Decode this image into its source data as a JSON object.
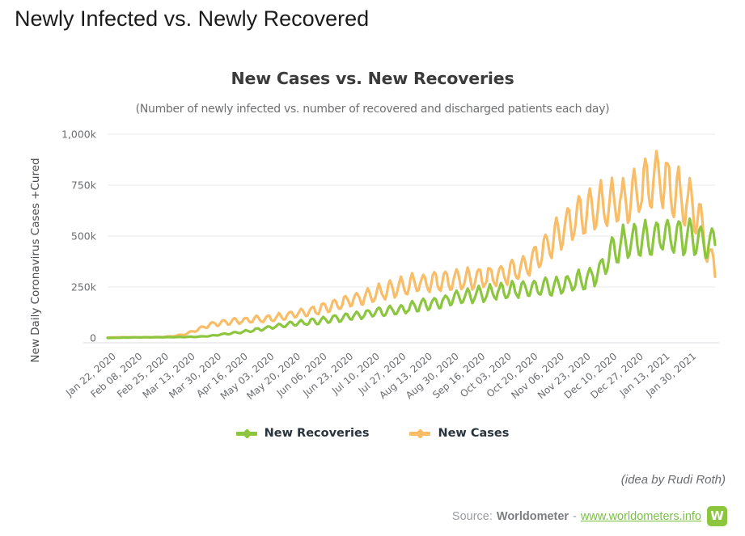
{
  "page": {
    "title": "Newly Infected vs. Newly Recovered"
  },
  "chart_data": {
    "type": "line",
    "title": "New Cases vs. New Recoveries",
    "subtitle": "(Number of newly infected vs. number of recovered and discharged patients each day)",
    "xlabel": "",
    "ylabel": "New Daily Coronavirus Cases +Cured",
    "ylim": [
      0,
      1000000
    ],
    "ytick_labels": [
      "0",
      "250k",
      "500k",
      "750k",
      "1,000k"
    ],
    "ytick_values": [
      0,
      250000,
      500000,
      750000,
      1000000
    ],
    "grid": true,
    "legend_position": "bottom",
    "colors": {
      "new_cases": "#f9bd68",
      "new_recoveries": "#8cc63e",
      "gridline": "#e8e9ea",
      "axisline": "#d9dce3",
      "text": "#6b6d70"
    },
    "xtick_labels": [
      "Jan 22, 2020",
      "Feb 08, 2020",
      "Feb 25, 2020",
      "Mar 13, 2020",
      "Mar 30, 2020",
      "Apr 16, 2020",
      "May 03, 2020",
      "May 20, 2020",
      "Jun 06, 2020",
      "Jun 23, 2020",
      "Jul 10, 2020",
      "Jul 27, 2020",
      "Aug 13, 2020",
      "Aug 30, 2020",
      "Sep 16, 2020",
      "Oct 03, 2020",
      "Oct 20, 2020",
      "Nov 06, 2020",
      "Nov 23, 2020",
      "Dec 10, 2020",
      "Dec 27, 2020",
      "Jan 13, 2021",
      "Jan 30, 2021"
    ],
    "x_start": "Jan 22, 2020",
    "x_end": "Feb 08, 2021",
    "n_points": 384,
    "series": [
      {
        "name": "New Recoveries",
        "color": "#8cc63e",
        "weekly_values": [
          0,
          1000,
          2000,
          3000,
          3000,
          3500,
          4000,
          4500,
          6000,
          9000,
          16000,
          23000,
          30000,
          38000,
          47000,
          58000,
          66000,
          72000,
          78000,
          85000,
          93000,
          101000,
          110000,
          118000,
          127000,
          133000,
          140000,
          150000,
          160000,
          172000,
          183000,
          196000,
          205000,
          213000,
          220000,
          228000,
          235000,
          240000,
          245000,
          250000,
          258000,
          268000,
          280000,
          300000,
          340000,
          430000,
          470000,
          480000,
          490000,
          500000,
          505000,
          500000,
          490000,
          475000,
          465000
        ]
      },
      {
        "name": "New Cases",
        "color": "#f9bd68",
        "weekly_values": [
          2000,
          3000,
          3500,
          3000,
          3500,
          5000,
          10000,
          20000,
          40000,
          65000,
          75000,
          80000,
          85000,
          90000,
          95000,
          100000,
          110000,
          120000,
          130000,
          145000,
          160000,
          175000,
          190000,
          205000,
          220000,
          235000,
          250000,
          265000,
          270000,
          275000,
          280000,
          285000,
          290000,
          295000,
          300000,
          310000,
          325000,
          350000,
          390000,
          440000,
          500000,
          560000,
          600000,
          630000,
          650000,
          660000,
          670000,
          700000,
          760000,
          790000,
          740000,
          690000,
          640000,
          600000,
          560000
        ]
      }
    ],
    "peak_new_cases": 855000,
    "peak_new_recoveries": 560000,
    "final_new_cases": 320000,
    "final_new_recoveries": 480000
  },
  "legend": {
    "items": [
      {
        "label": "New Recoveries",
        "color": "#8cc63e"
      },
      {
        "label": "New Cases",
        "color": "#f9bd68"
      }
    ]
  },
  "footer": {
    "credit": "(idea by Rudi Roth)",
    "source_prefix": "Source:",
    "source_brand": "Worldometer",
    "source_dash": "-",
    "source_link": "www.worldometers.info",
    "badge_letter": "W"
  }
}
